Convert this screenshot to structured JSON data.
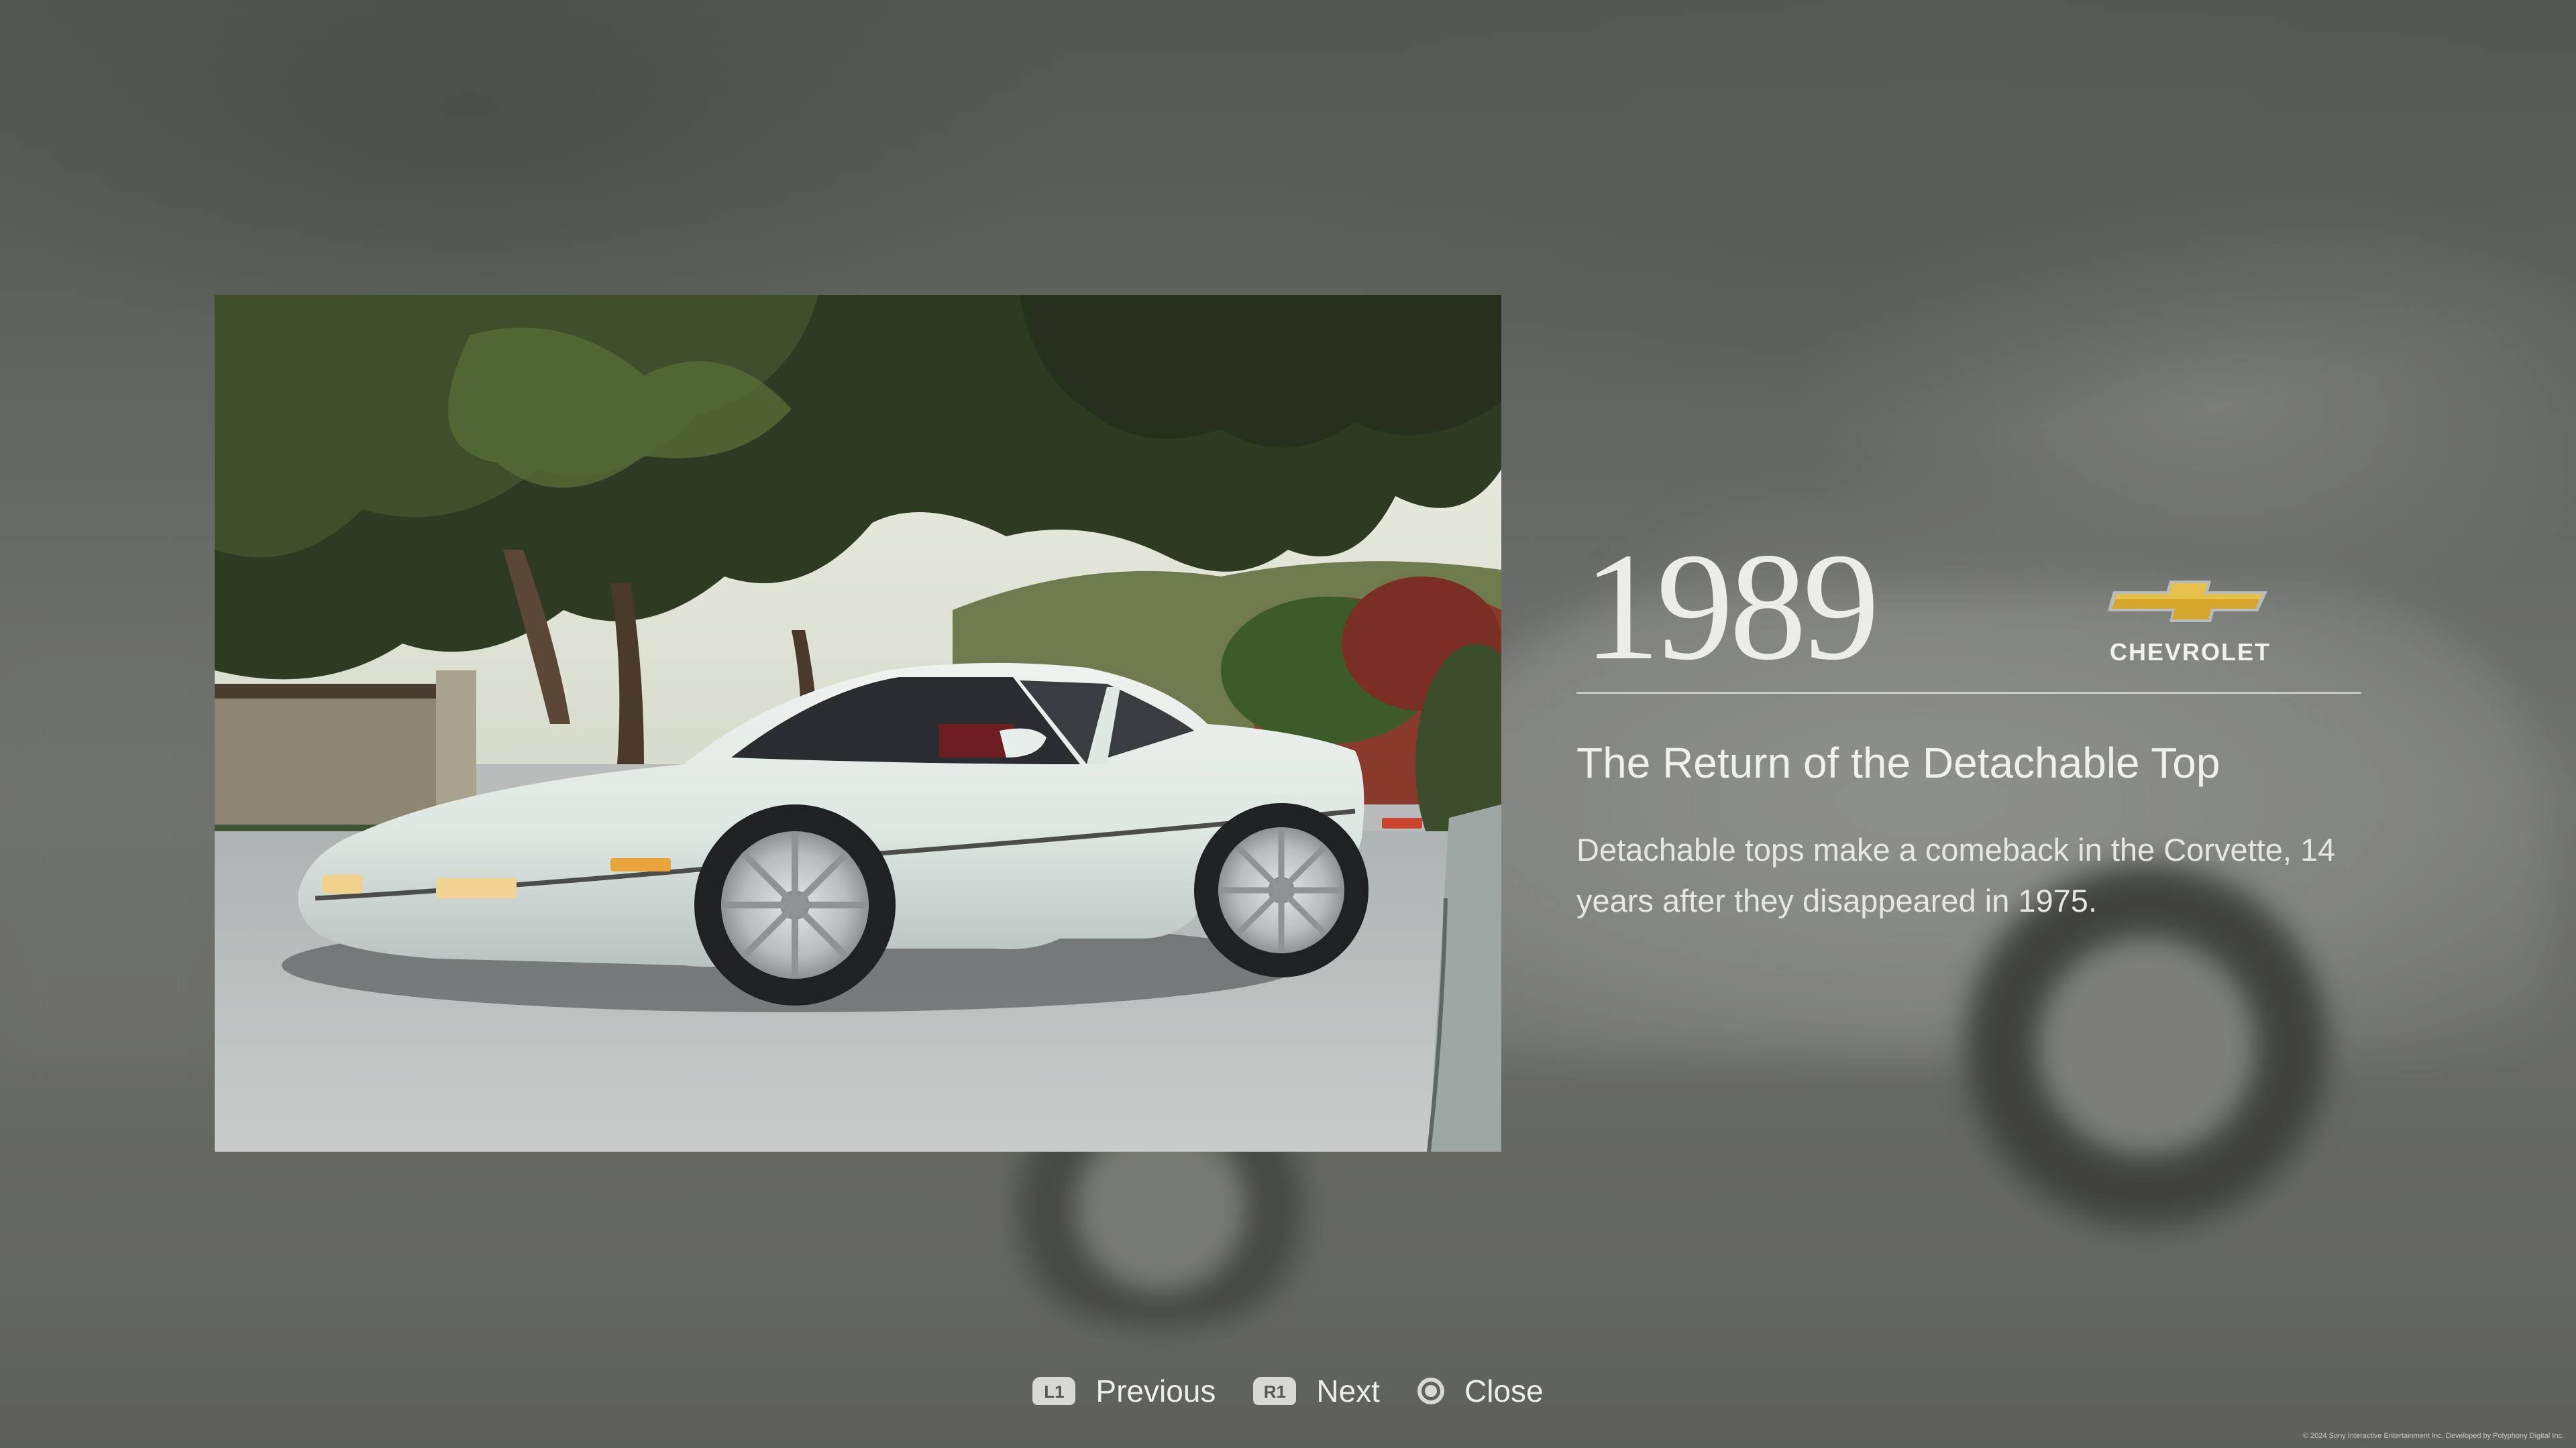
{
  "gallery": {
    "photo_alt": "1989 Chevrolet Corvette",
    "year": "1989",
    "brand": "CHEVROLET",
    "headline": "The Return of the Detachable Top",
    "body": "Detachable tops make a comeback in the Corvette, 14 years after they disappeared in 1975."
  },
  "controls": {
    "previous": {
      "badge": "L1",
      "label": "Previous"
    },
    "next": {
      "badge": "R1",
      "label": "Next"
    },
    "close": {
      "icon": "circle-button-icon",
      "label": "Close"
    }
  },
  "footer": {
    "copyright": "© 2024 Sony Interactive Entertainment Inc. Developed by Polyphony Digital Inc."
  },
  "colors": {
    "bowtie_gold": "#d4a62a",
    "text_light": "#efefed"
  }
}
